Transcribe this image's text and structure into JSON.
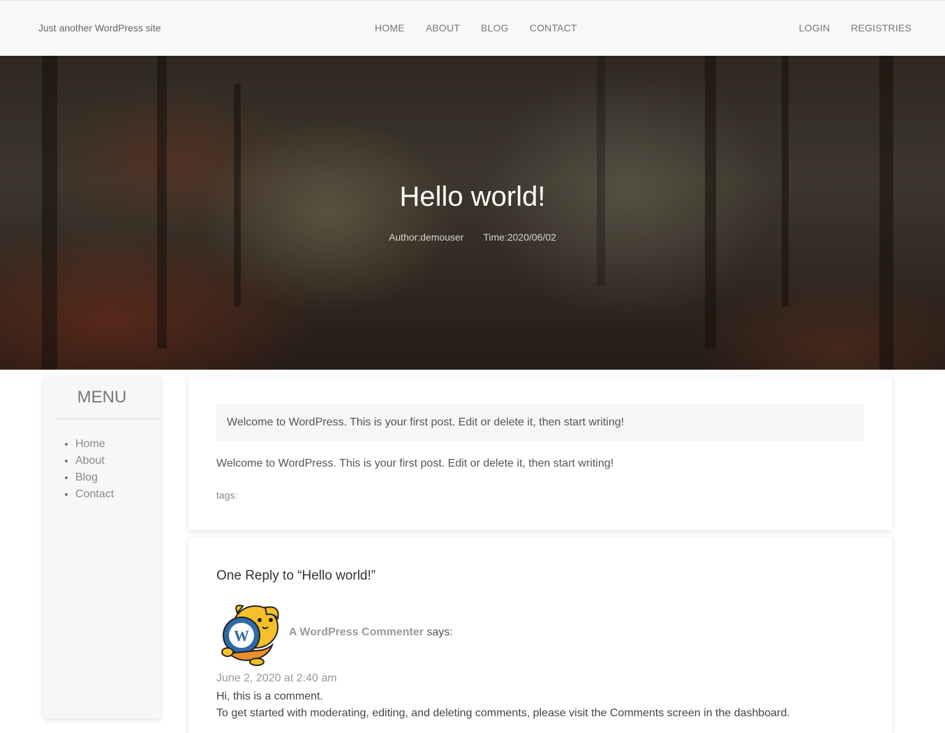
{
  "header": {
    "tagline": "Just another WordPress site",
    "nav": [
      "HOME",
      "ABOUT",
      "BLOG",
      "CONTACT"
    ],
    "auth": [
      "LOGIN",
      "REGISTRIES"
    ]
  },
  "hero": {
    "title": "Hello world!",
    "author": "Author:demouser",
    "time": "Time:2020/06/02"
  },
  "sidebar": {
    "title": "MENU",
    "items": [
      "Home",
      "About",
      "Blog",
      "Contact"
    ]
  },
  "post": {
    "excerpt": "Welcome to WordPress. This is your first post. Edit or delete it, then start writing!",
    "body": "Welcome to WordPress. This is your first post. Edit or delete it, then start writing!",
    "tags_label": "tags:"
  },
  "comments": {
    "title": "One Reply to “Hello world!”",
    "commenter": "A WordPress Commenter",
    "says": "says:",
    "date": "June 2, 2020 at 2:40 am",
    "text1": "Hi, this is a comment.",
    "text2": "To get started with moderating, editing, and deleting comments, please visit the Comments screen in the dashboard.",
    "avatar_icon": "wapuu-avatar-icon"
  }
}
